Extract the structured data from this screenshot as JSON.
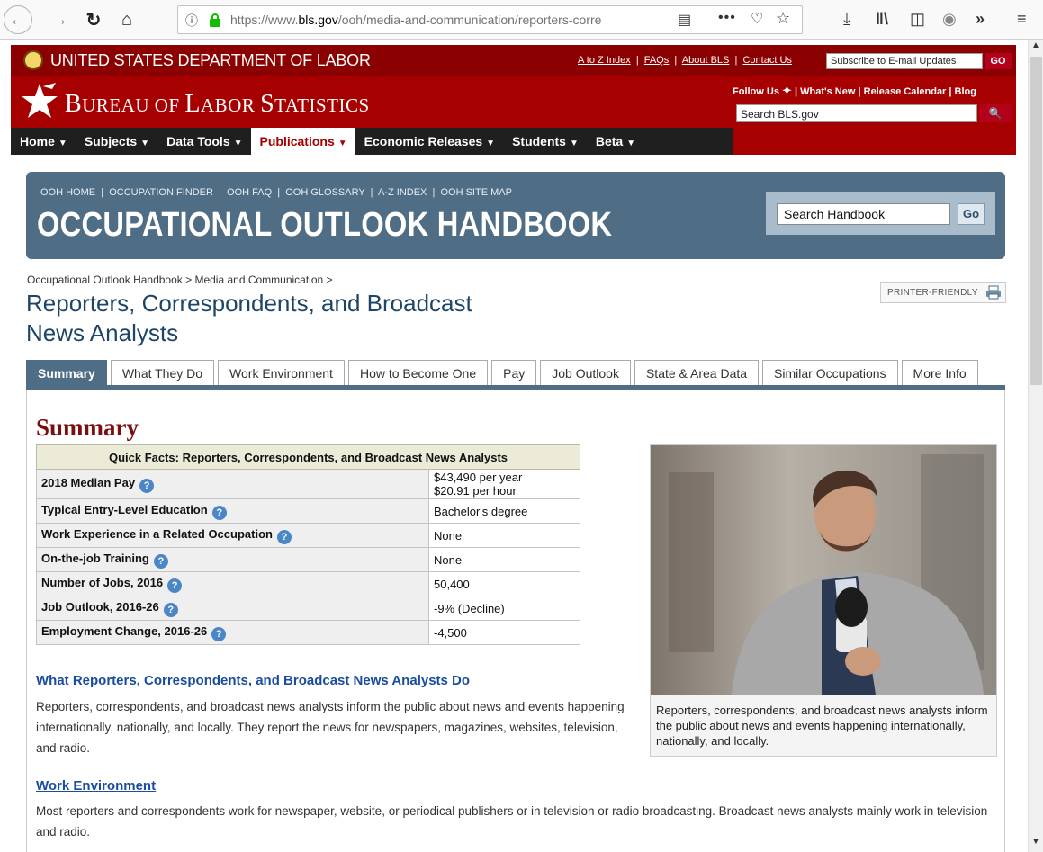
{
  "browser": {
    "url_prefix": "https://www.",
    "url_domain": "bls.gov",
    "url_path": "/ooh/media-and-communication/reporters-corre",
    "more_label": "•••"
  },
  "dol": {
    "title": "UNITED STATES DEPARTMENT OF LABOR",
    "links": [
      "A to Z Index",
      "FAQs",
      "About BLS",
      "Contact Us"
    ],
    "subscribe_placeholder": "Subscribe to E-mail Updates",
    "go_label": "GO"
  },
  "bls": {
    "title_b": "B",
    "title_ureau": "UREAU OF ",
    "title_l": "L",
    "title_abor": "ABOR ",
    "title_s": "S",
    "title_tatistics": "TATISTICS",
    "follow_us": "Follow Us",
    "top_links": [
      "What's New",
      "Release Calendar",
      "Blog"
    ],
    "search_placeholder": "Search BLS.gov"
  },
  "nav": {
    "items": [
      "Home",
      "Subjects",
      "Data Tools",
      "Publications",
      "Economic Releases",
      "Students",
      "Beta"
    ]
  },
  "ooh": {
    "links": [
      "OOH HOME",
      "OCCUPATION FINDER",
      "OOH FAQ",
      "OOH GLOSSARY",
      "A-Z INDEX",
      "OOH SITE MAP"
    ],
    "title": "OCCUPATIONAL OUTLOOK HANDBOOK",
    "search_value": "Search Handbook",
    "go_label": "Go"
  },
  "breadcrumb": "Occupational Outlook Handbook > Media and Communication >",
  "page_title_line1": "Reporters, Correspondents, and Broadcast",
  "page_title_line2": "News Analysts",
  "printer_label": "PRINTER-FRIENDLY",
  "tabs": [
    "Summary",
    "What They Do",
    "Work Environment",
    "How to Become One",
    "Pay",
    "Job Outlook",
    "State & Area Data",
    "Similar Occupations",
    "More Info"
  ],
  "summary": {
    "heading": "Summary",
    "table_title": "Quick Facts: Reporters, Correspondents, and Broadcast News Analysts",
    "rows": [
      {
        "label": "2018 Median Pay",
        "value": "$43,490 per year",
        "value2": "$20.91 per hour"
      },
      {
        "label": "Typical Entry-Level Education",
        "value": "Bachelor's degree"
      },
      {
        "label": "Work Experience in a Related Occupation",
        "value": "None"
      },
      {
        "label": "On-the-job Training",
        "value": "None"
      },
      {
        "label": "Number of Jobs, 2016",
        "value": "50,400"
      },
      {
        "label": "Job Outlook, 2016-26",
        "value": "-9% (Decline)"
      },
      {
        "label": "Employment Change, 2016-26",
        "value": "-4,500"
      }
    ],
    "caption": "Reporters, correspondents, and broadcast news analysts inform the public about news and events happening internationally, nationally, and locally."
  },
  "sections": {
    "what_they_do_title": "What Reporters, Correspondents, and Broadcast News Analysts Do",
    "what_they_do_text": "Reporters, correspondents, and broadcast news analysts inform the public about news and events happening internationally, nationally, and locally. They report the news for newspapers, magazines, websites, television, and radio.",
    "work_env_title": "Work Environment",
    "work_env_text": "Most reporters and correspondents work for newspaper, website, or periodical publishers or in television or radio broadcasting. Broadcast news analysts mainly work in television and radio."
  },
  "colors": {
    "dol_red": "#8b0000",
    "bls_red": "#a60000",
    "ooh_blue": "#4f6d84",
    "link_blue": "#1a4c9f",
    "summary_red": "#7a0f0f"
  }
}
